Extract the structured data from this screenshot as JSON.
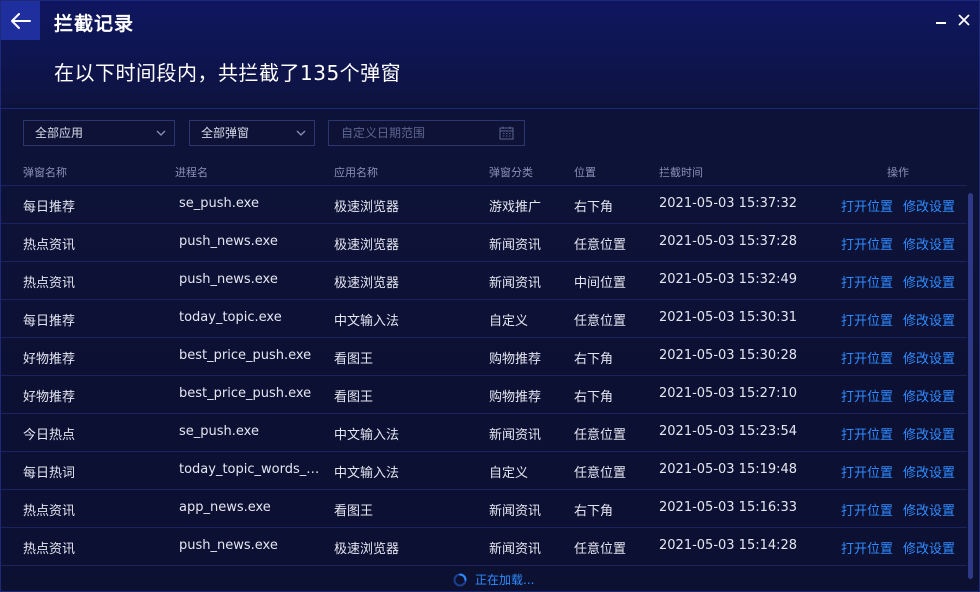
{
  "header": {
    "title": "拦截记录",
    "summary": "在以下时间段内，共拦截了135个弹窗"
  },
  "filters": {
    "app_select": "全部应用",
    "popup_select": "全部弹窗",
    "date_placeholder": "自定义日期范围"
  },
  "table": {
    "columns": [
      "弹窗名称",
      "进程名",
      "应用名称",
      "弹窗分类",
      "位置",
      "拦截时间",
      "操作"
    ],
    "rows": [
      {
        "name": "每日推荐",
        "process": "se_push.exe",
        "app": "极速浏览器",
        "category": "游戏推广",
        "position": "右下角",
        "time": "2021-05-03 15:37:32",
        "open": "打开位置",
        "edit": "修改设置"
      },
      {
        "name": "热点资讯",
        "process": "push_news.exe",
        "app": "极速浏览器",
        "category": "新闻资讯",
        "position": "任意位置",
        "time": "2021-05-03 15:37:28",
        "open": "打开位置",
        "edit": "修改设置"
      },
      {
        "name": "热点资讯",
        "process": "push_news.exe",
        "app": "极速浏览器",
        "category": "新闻资讯",
        "position": "中间位置",
        "time": "2021-05-03 15:32:49",
        "open": "打开位置",
        "edit": "修改设置"
      },
      {
        "name": "每日推荐",
        "process": "today_topic.exe",
        "app": "中文输入法",
        "category": "自定义",
        "position": "任意位置",
        "time": "2021-05-03 15:30:31",
        "open": "打开位置",
        "edit": "修改设置"
      },
      {
        "name": "好物推荐",
        "process": "best_price_push.exe",
        "app": "看图王",
        "category": "购物推荐",
        "position": "右下角",
        "time": "2021-05-03 15:30:28",
        "open": "打开位置",
        "edit": "修改设置"
      },
      {
        "name": "好物推荐",
        "process": "best_price_push.exe",
        "app": "看图王",
        "category": "购物推荐",
        "position": "右下角",
        "time": "2021-05-03 15:27:10",
        "open": "打开位置",
        "edit": "修改设置"
      },
      {
        "name": "今日热点",
        "process": "se_push.exe",
        "app": "中文输入法",
        "category": "新闻资讯",
        "position": "任意位置",
        "time": "2021-05-03 15:23:54",
        "open": "打开位置",
        "edit": "修改设置"
      },
      {
        "name": "每日热词",
        "process": "today_topic_words_pu...",
        "app": "中文输入法",
        "category": "自定义",
        "position": "任意位置",
        "time": "2021-05-03 15:19:48",
        "open": "打开位置",
        "edit": "修改设置"
      },
      {
        "name": "热点资讯",
        "process": "app_news.exe",
        "app": "看图王",
        "category": "新闻资讯",
        "position": "右下角",
        "time": "2021-05-03 15:16:33",
        "open": "打开位置",
        "edit": "修改设置"
      },
      {
        "name": "热点资讯",
        "process": "push_news.exe",
        "app": "极速浏览器",
        "category": "新闻资讯",
        "position": "任意位置",
        "time": "2021-05-03 15:14:28",
        "open": "打开位置",
        "edit": "修改设置"
      }
    ]
  },
  "footer": {
    "loading": "正在加载..."
  },
  "colors": {
    "accent": "#2f8cff",
    "background": "#0c1031",
    "back_button": "#1f2f9e"
  },
  "icons": [
    "back-arrow-icon",
    "minimize-icon",
    "close-icon",
    "chevron-down-icon",
    "calendar-icon",
    "spinner-icon"
  ]
}
